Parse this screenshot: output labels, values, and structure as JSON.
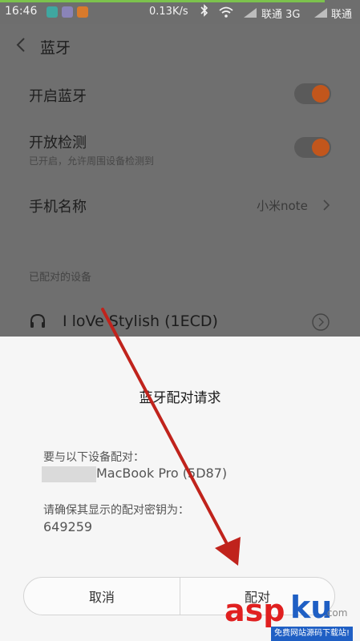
{
  "status_bar": {
    "time": "16:46",
    "speed": "0.13K/s",
    "carrier_1": "联通 3G",
    "carrier_2": "联通",
    "colors": {
      "progress": "#7cc24d"
    }
  },
  "settings": {
    "title": "蓝牙",
    "rows": {
      "enable_label": "开启蓝牙",
      "enable_on": true,
      "discover_label": "开放检测",
      "discover_sub": "已开启，允许周围设备检测到",
      "discover_on": true,
      "name_label": "手机名称",
      "name_value": "小米note"
    },
    "paired_header": "已配对的设备",
    "paired_device": "I loVe Stylish (1ECD)",
    "icons": {
      "back": "chevron-left-icon",
      "detail": "chevron-right-icon",
      "device": "headset-icon",
      "device_detail": "circle-chevron-icon"
    }
  },
  "dialog": {
    "title": "蓝牙配对请求",
    "pair_with": "要与以下设备配对：",
    "device_name": "MacBook Pro (5D87)",
    "confirm_text": "请确保其显示的配对密钥为：",
    "passkey": "649259",
    "cancel_label": "取消",
    "pair_label": "配对"
  },
  "accent_color": "#c2561c",
  "watermark": {
    "brand_a": "asp",
    "brand_b": "ku",
    "suffix": ".com",
    "tagline": "免费网站源码下载站!"
  }
}
